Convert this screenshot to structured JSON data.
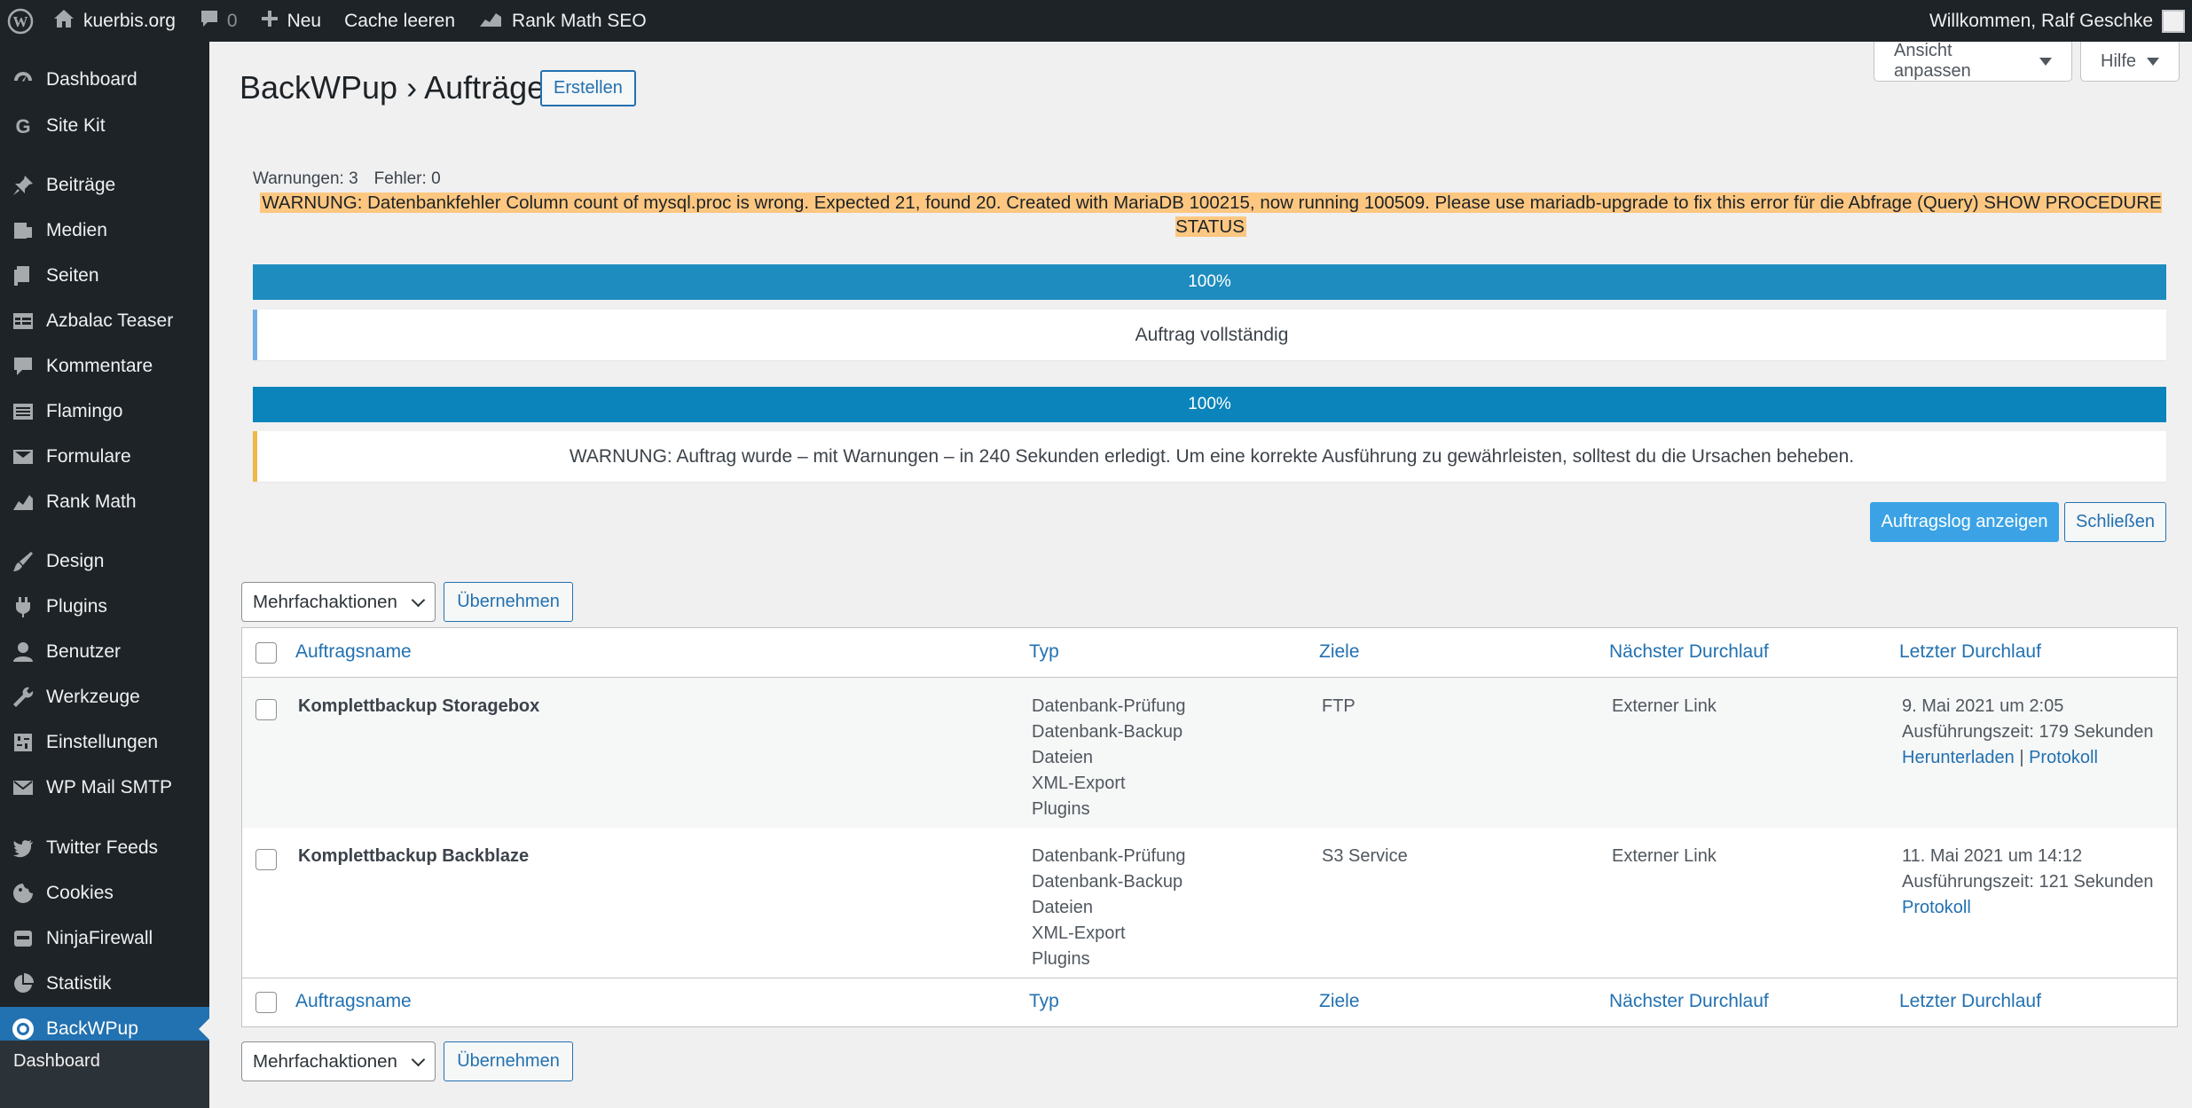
{
  "adminbar": {
    "site_name": "kuerbis.org",
    "comments_count": "0",
    "new_label": "Neu",
    "cache_label": "Cache leeren",
    "rankmath_label": "Rank Math SEO",
    "welcome": "Willkommen, Ralf Geschke"
  },
  "sidebar": {
    "items": [
      {
        "label": "Dashboard",
        "icon": "dashboard-icon"
      },
      {
        "label": "Site Kit",
        "icon": "google-g-icon"
      },
      {
        "label": "Beiträge",
        "icon": "pin-icon"
      },
      {
        "label": "Medien",
        "icon": "media-icon"
      },
      {
        "label": "Seiten",
        "icon": "pages-icon"
      },
      {
        "label": "Azbalac Teaser",
        "icon": "table-icon"
      },
      {
        "label": "Kommentare",
        "icon": "comment-icon"
      },
      {
        "label": "Flamingo",
        "icon": "list-icon"
      },
      {
        "label": "Formulare",
        "icon": "mail-icon"
      },
      {
        "label": "Rank Math",
        "icon": "chart-icon"
      },
      {
        "label": "Design",
        "icon": "brush-icon"
      },
      {
        "label": "Plugins",
        "icon": "plugin-icon"
      },
      {
        "label": "Benutzer",
        "icon": "user-icon"
      },
      {
        "label": "Werkzeuge",
        "icon": "wrench-icon"
      },
      {
        "label": "Einstellungen",
        "icon": "settings-icon"
      },
      {
        "label": "WP Mail SMTP",
        "icon": "mail-smtp-icon"
      },
      {
        "label": "Twitter Feeds",
        "icon": "twitter-icon"
      },
      {
        "label": "Cookies",
        "icon": "cookie-icon"
      },
      {
        "label": "NinjaFirewall",
        "icon": "ninja-icon"
      },
      {
        "label": "Statistik",
        "icon": "pie-icon"
      },
      {
        "label": "BackWPup",
        "icon": "backwpup-icon"
      }
    ],
    "submenu": "Dashboard"
  },
  "screen_options": {
    "label": "Ansicht anpassen",
    "help": "Hilfe"
  },
  "header": {
    "title": "BackWPup › Aufträge",
    "create": "Erstellen"
  },
  "warnings": {
    "warn_count": "Warnungen: 3",
    "error_count": "Fehler: 0",
    "message": "WARNUNG: Datenbankfehler Column count of mysql.proc is wrong. Expected 21, found 20. Created with MariaDB 100215, now running 100509. Please use mariadb-upgrade to fix this error für die Abfrage (Query) SHOW PROCEDURE STATUS"
  },
  "progress": [
    {
      "percent": "100%",
      "message": "Auftrag vollständig",
      "bar_color": "#1e8cbe",
      "border_color": "#72aee6"
    },
    {
      "percent": "100%",
      "message": "WARNUNG: Auftrag wurde – mit Warnungen – in 240 Sekunden erledigt. Um eine korrekte Ausführung zu gewährleisten, solltest du die Ursachen beheben.",
      "bar_color": "#0a84bb",
      "border_color": "#f0b849"
    }
  ],
  "actions": {
    "log": "Auftragslog anzeigen",
    "close": "Schließen"
  },
  "bulk": {
    "select": "Mehrfachaktionen",
    "apply": "Übernehmen"
  },
  "table": {
    "columns": [
      "Auftragsname",
      "Typ",
      "Ziele",
      "Nächster Durchlauf",
      "Letzter Durchlauf"
    ],
    "rows": [
      {
        "name": "Komplettbackup Storagebox",
        "types": [
          "Datenbank-Prüfung",
          "Datenbank-Backup",
          "Dateien",
          "XML-Export",
          "Plugins"
        ],
        "target": "FTP",
        "next": "Externer Link",
        "last": "9. Mai 2021 um 2:05",
        "runtime": "Ausführungszeit: 179 Sekunden",
        "download": "Herunterladen",
        "sep": "|",
        "log": "Protokoll"
      },
      {
        "name": "Komplettbackup Backblaze",
        "types": [
          "Datenbank-Prüfung",
          "Datenbank-Backup",
          "Dateien",
          "XML-Export",
          "Plugins"
        ],
        "target": "S3 Service",
        "next": "Externer Link",
        "last": "11. Mai 2021 um 14:12",
        "runtime": "Ausführungszeit: 121 Sekunden",
        "log": "Protokoll"
      }
    ]
  }
}
